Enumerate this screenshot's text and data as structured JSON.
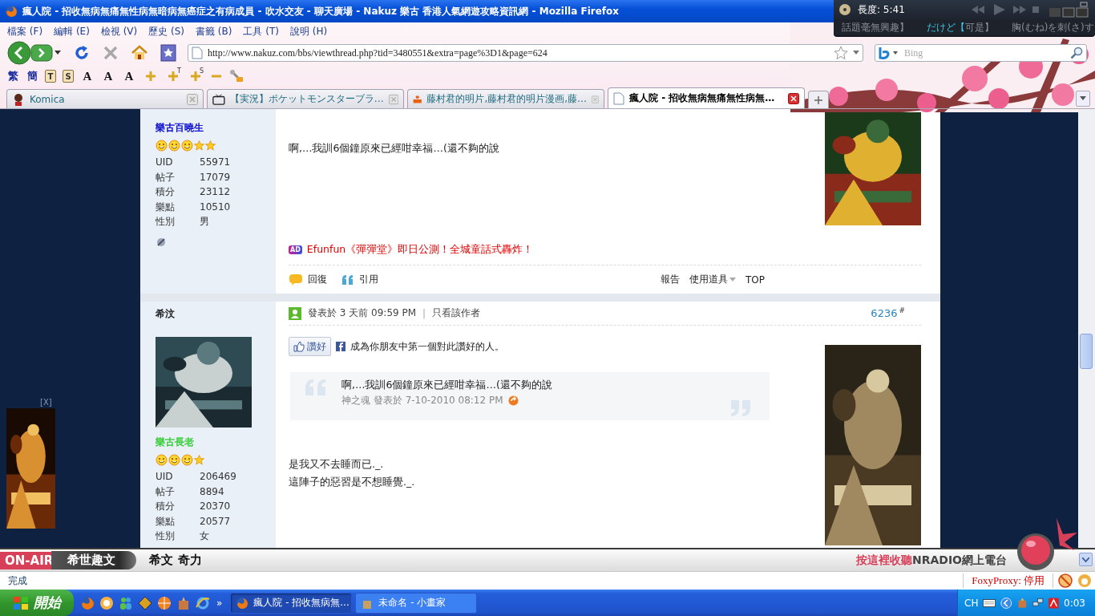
{
  "window": {
    "title": "瘋人院 - 招收無病無痛無性病無暗病無癌症之有病成員 - 吹水交友 - 聊天廣場 - Nakuz 樂古 香港人氣網遊攻略資訊網 - Mozilla Firefox"
  },
  "media_player": {
    "duration": "長度: 5:41",
    "lyrics": [
      {
        "text": "話題毫無興趣】",
        "current": false
      },
      {
        "text": "だけど【",
        "current": true
      },
      {
        "text": "可是】",
        "current": false
      },
      {
        "text": "胸(むね)を刺(さ)す",
        "current": false
      }
    ]
  },
  "menu": [
    "檔案 (F)",
    "編輯 (E)",
    "檢視 (V)",
    "歷史 (S)",
    "書籤 (B)",
    "工具 (T)",
    "說明 (H)"
  ],
  "address": {
    "url": "http://www.nakuz.com/bbs/viewthread.php?tid=3480551&extra=page%3D1&page=624"
  },
  "search": {
    "placeholder": "Bing"
  },
  "addon_toolbar": [
    {
      "kind": "text",
      "label": "繁"
    },
    {
      "kind": "text",
      "label": "簡"
    },
    {
      "kind": "doc",
      "label": "T"
    },
    {
      "kind": "doc",
      "label": "S"
    },
    {
      "kind": "font",
      "label": "A"
    },
    {
      "kind": "font",
      "label": "A"
    },
    {
      "kind": "font",
      "label": "A"
    },
    {
      "kind": "plus"
    },
    {
      "kind": "plus",
      "sup": "T"
    },
    {
      "kind": "plus",
      "sup": "S"
    },
    {
      "kind": "minus"
    },
    {
      "kind": "tool"
    }
  ],
  "tabs": [
    {
      "kind": "character",
      "label": "Komica",
      "selected": false
    },
    {
      "kind": "tv",
      "label": "【実況】ポケットモンスターブラ…",
      "selected": false
    },
    {
      "kind": "dm",
      "label": "藤村君的明片,藤村君的明片漫画,藤…",
      "selected": false
    },
    {
      "kind": "page",
      "label": "瘋人院 - 招收無病無痛無性病無…",
      "selected": true
    }
  ],
  "left_ad": {
    "close": "[X]"
  },
  "posts": [
    {
      "rank_title": "樂古百曉生",
      "color": "#0000cc",
      "rank_icons": [
        {
          "kind": "smiley"
        },
        {
          "kind": "smiley"
        },
        {
          "kind": "smiley"
        },
        {
          "kind": "star"
        },
        {
          "kind": "star"
        }
      ],
      "stats": [
        {
          "label": "UID",
          "value": "55971"
        },
        {
          "label": "帖子",
          "value": "17079"
        },
        {
          "label": "積分",
          "value": "23112"
        },
        {
          "label": "樂點",
          "value": "10510"
        },
        {
          "label": "性別",
          "value": "男"
        }
      ],
      "online_icon": true,
      "body": [
        "啊,…我訓6個鐘原來已經咁幸福…(還不夠的說"
      ],
      "ad_link": {
        "badge": "AD",
        "text": "Efunfun《彈彈堂》即日公測！全城童話式轟炸！"
      },
      "actions": {
        "reply": "回復",
        "quote": "引用",
        "report": "報告",
        "tools": "使用道具",
        "top": "TOP"
      }
    },
    {
      "username": "希汶",
      "rank_title": "樂古長老",
      "color": "#33cc33",
      "rank_icons": [
        {
          "kind": "smiley"
        },
        {
          "kind": "smiley"
        },
        {
          "kind": "smiley"
        },
        {
          "kind": "star"
        }
      ],
      "avatar": {
        "kind": "picture"
      },
      "stats": [
        {
          "label": "UID",
          "value": "206469"
        },
        {
          "label": "帖子",
          "value": "8894"
        },
        {
          "label": "積分",
          "value": "20370"
        },
        {
          "label": "樂點",
          "value": "20577"
        },
        {
          "label": "性別",
          "value": "女"
        }
      ],
      "online_icon": false,
      "header": {
        "posted": "發表於 3 天前 09:59 PM",
        "separator": "|",
        "author_only": "只看該作者",
        "floor": "6236",
        "floor_mark": "#"
      },
      "like": {
        "button": "讚好",
        "text": "成為你朋友中第一個對此讚好的人。"
      },
      "quote": {
        "text": "啊,…我訓6個鐘原來已經咁幸福…(還不夠的說",
        "meta": "神之魂 發表於 7-10-2010 08:12 PM"
      },
      "body": [
        "是我又不去睡而已._.",
        "這陣子的惡習是不想睡覺._."
      ]
    }
  ],
  "radio_bar": {
    "on_air": "ON-AIR",
    "program": "希世趣文",
    "host": "希文 奇力",
    "cta_highlight": "按這裡收聽",
    "cta_rest": "NRADIO網上電台"
  },
  "status_bar": {
    "text": "完成",
    "proxy": "FoxyProxy: 停用"
  },
  "taskbar": {
    "start": "開始",
    "more": "»",
    "tasks": [
      {
        "kind": "firefox",
        "label": "瘋人院 - 招收無病無...",
        "selected": true
      },
      {
        "kind": "paint",
        "label": "未命名 - 小畫家",
        "selected": false
      }
    ],
    "language": "CH",
    "clock": "0:03"
  }
}
